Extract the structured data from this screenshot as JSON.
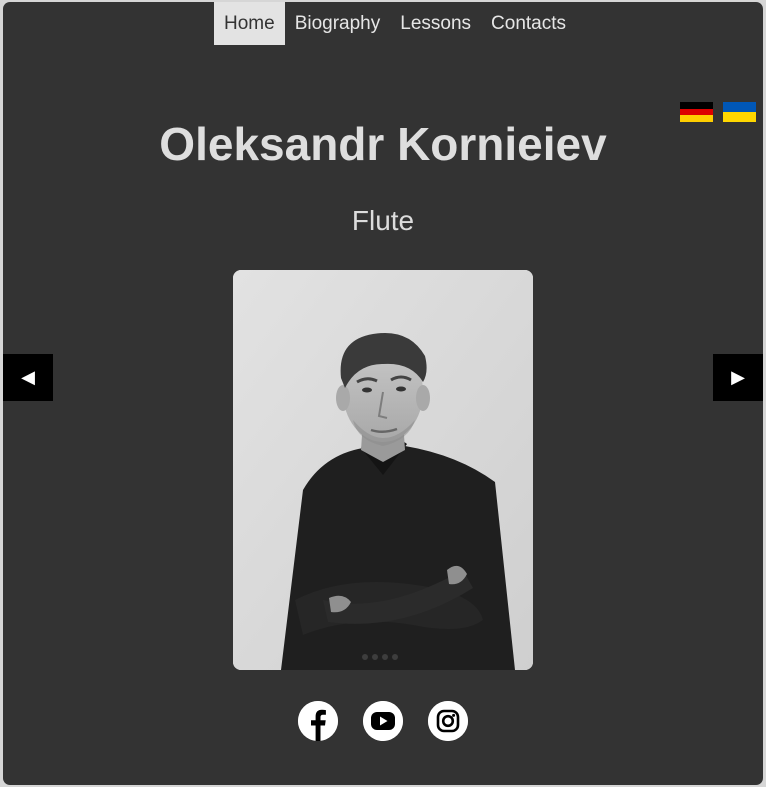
{
  "nav": {
    "items": [
      {
        "label": "Home",
        "active": true
      },
      {
        "label": "Biography",
        "active": false
      },
      {
        "label": "Lessons",
        "active": false
      },
      {
        "label": "Contacts",
        "active": false
      }
    ]
  },
  "languages": [
    {
      "code": "de",
      "icon": "germany-flag-icon",
      "colors": [
        "#000000",
        "#dd0000",
        "#ffce00"
      ]
    },
    {
      "code": "uk",
      "icon": "ukraine-flag-icon",
      "colors": [
        "#0057b7",
        "#ffd700"
      ]
    }
  ],
  "hero": {
    "name": "Oleksandr Kornieiev",
    "instrument": "Flute"
  },
  "slider": {
    "prev_icon": "◀",
    "next_icon": "▶",
    "current_image": "portrait-photo"
  },
  "social": [
    {
      "name": "facebook",
      "icon": "facebook-icon"
    },
    {
      "name": "youtube",
      "icon": "youtube-icon"
    },
    {
      "name": "instagram",
      "icon": "instagram-icon"
    }
  ],
  "colors": {
    "background": "#333333",
    "nav_active_bg": "#e3e3e3",
    "text": "#dedede",
    "arrow_bg": "#000000"
  }
}
